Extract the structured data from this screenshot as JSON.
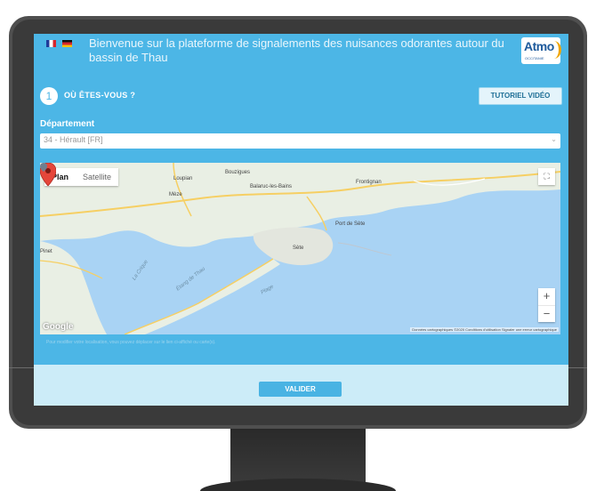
{
  "header": {
    "welcome_text": "Bienvenue sur la plateforme de signalements des nuisances odorantes autour du bassin de Thau",
    "logo_text": "Atmo",
    "logo_subtext": "OCCITANIE",
    "languages": [
      "fr-flag-icon",
      "de-flag-icon"
    ]
  },
  "step": {
    "number": "1",
    "title": "OÙ ÊTES-VOUS ?",
    "tutorial_label": "TUTORIEL VIDÉO"
  },
  "department": {
    "label": "Département",
    "selected": "34 - Hérault [FR]"
  },
  "map": {
    "type_plan": "Plan",
    "type_satellite": "Satellite",
    "places": {
      "loupian": "Loupian",
      "bouzigues": "Bouzigues",
      "balaruc": "Balaruc-les-Bains",
      "frontignan": "Frontignan",
      "meze": "Mèze",
      "sete": "Sète",
      "port_sete": "Port de Sète",
      "pinet": "Pinet",
      "etang": "Étang de Thau",
      "la_crique": "La Crique",
      "plage": "Plage"
    },
    "google_label": "Google",
    "attribution": "Données cartographiques ©2020   Conditions d'utilisation   Signaler une erreur cartographique",
    "zoom_in": "+",
    "zoom_out": "−"
  },
  "hint": "Pour modifier votre localisation, vous pouvez déplacer sur le lien ci-affiché ou carte(s).",
  "actions": {
    "submit_label": "VALIDER"
  },
  "colors": {
    "screen_bg": "#4cb6e6",
    "footer_bg": "#ccecf8",
    "bezel": "#4f4f4f",
    "water": "#a9d3f4",
    "land": "#e9efe4"
  }
}
